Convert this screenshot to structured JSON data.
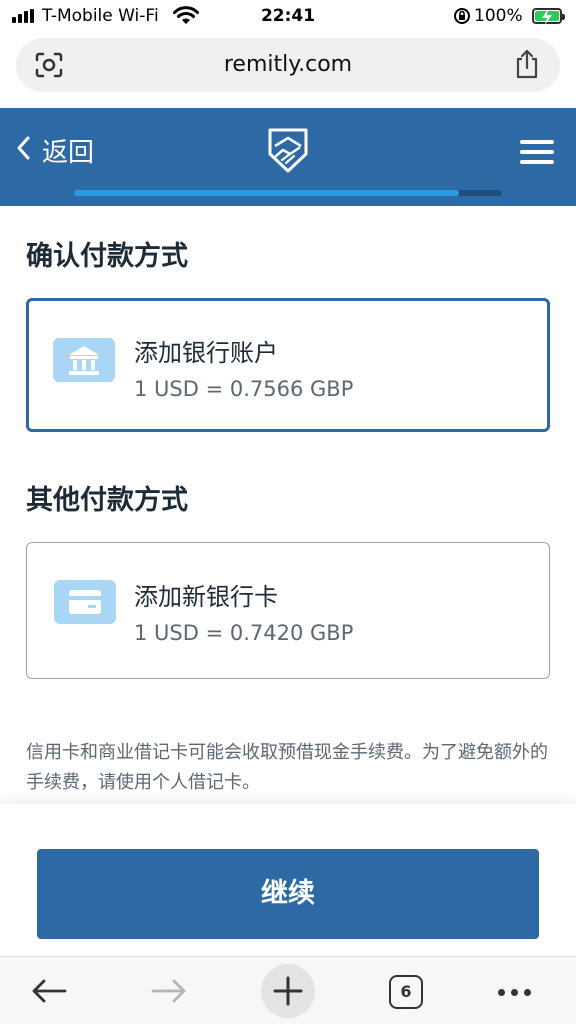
{
  "status_bar": {
    "carrier": "T-Mobile Wi-Fi",
    "time": "22:41",
    "battery": "100%"
  },
  "browser": {
    "url": "remitly.com",
    "open_tabs": "6"
  },
  "header": {
    "back_label": "返回",
    "progress_fraction": 0.9
  },
  "confirmed_section": {
    "title": "确认付款方式",
    "method": {
      "name": "添加银行账户",
      "rate": "1 USD = 0.7566 GBP",
      "icon": "bank-icon"
    }
  },
  "other_section": {
    "title": "其他付款方式",
    "method": {
      "name": "添加新银行卡",
      "rate": "1 USD = 0.7420 GBP",
      "icon": "credit-card-icon"
    }
  },
  "note": "信用卡和商业借记卡可能会收取预借现金手续费。为了避免额外的手续费，请使用个人借记卡。",
  "continue_label": "继续",
  "colors": {
    "brand": "#2d6aa5",
    "progress": "#2a9ae2",
    "icon_bg": "#a9d6f5"
  }
}
